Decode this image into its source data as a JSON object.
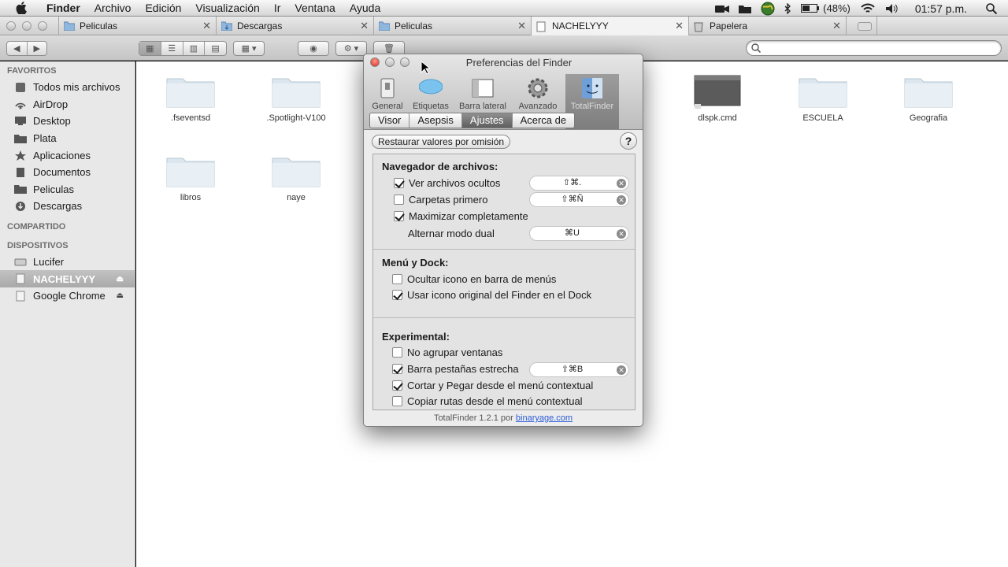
{
  "menubar": {
    "app_name": "Finder",
    "items": [
      "Archivo",
      "Edición",
      "Visualización",
      "Ir",
      "Ventana",
      "Ayuda"
    ],
    "battery": "(48%)",
    "clock": "01:57 p.m."
  },
  "tabs": [
    {
      "label": "Peliculas",
      "icon": "folder-icon"
    },
    {
      "label": "Descargas",
      "icon": "downloads-folder-icon"
    },
    {
      "label": "Peliculas",
      "icon": "folder-icon"
    },
    {
      "label": "NACHELYYY",
      "icon": "drive-icon"
    },
    {
      "label": "Papelera",
      "icon": "trash-icon"
    }
  ],
  "sidebar": {
    "favorites_header": "FAVORITOS",
    "favorites": [
      "Todos mis archivos",
      "AirDrop",
      "Desktop",
      "Plata",
      "Aplicaciones",
      "Documentos",
      "Peliculas",
      "Descargas"
    ],
    "shared_header": "COMPARTIDO",
    "devices_header": "DISPOSITIVOS",
    "devices": [
      "Lucifer",
      "NACHELYYY",
      "Google Chrome"
    ]
  },
  "files": [
    ".fseventsd",
    ".Spotlight-V100",
    "dlspk.cmd",
    "ESCUELA",
    "Geografia",
    "libros",
    "naye"
  ],
  "dialog": {
    "title": "Preferencias del Finder",
    "pref_tabs": [
      "General",
      "Etiquetas",
      "Barra lateral",
      "Avanzado",
      "TotalFinder"
    ],
    "segments": [
      "Visor",
      "Asepsis",
      "Ajustes",
      "Acerca de"
    ],
    "restore_label": "Restaurar valores por omisión",
    "help_label": "?",
    "sections": {
      "browser": {
        "title": "Navegador de archivos:",
        "options": [
          {
            "label": "Ver archivos ocultos",
            "checked": true,
            "shortcut": "⇧⌘."
          },
          {
            "label": "Carpetas primero",
            "checked": false,
            "shortcut": "⇧⌘Ñ"
          },
          {
            "label": "Maximizar completamente",
            "checked": true
          },
          {
            "label": "Alternar modo dual",
            "shortcut": "⌘U"
          }
        ]
      },
      "dock": {
        "title": "Menú y Dock:",
        "options": [
          {
            "label": "Ocultar icono en barra de menús",
            "checked": false
          },
          {
            "label": "Usar icono original del Finder en el Dock",
            "checked": true
          }
        ]
      },
      "experimental": {
        "title": "Experimental:",
        "options": [
          {
            "label": "No agrupar ventanas",
            "checked": false
          },
          {
            "label": "Barra pestañas estrecha",
            "checked": true,
            "shortcut": "⇧⌘B"
          },
          {
            "label": "Cortar y Pegar desde el menú contextual",
            "checked": true
          },
          {
            "label": "Copiar rutas desde el menú contextual",
            "checked": false
          }
        ]
      }
    },
    "footer_text": "TotalFinder 1.2.1 por",
    "footer_link": "binaryage.com"
  }
}
